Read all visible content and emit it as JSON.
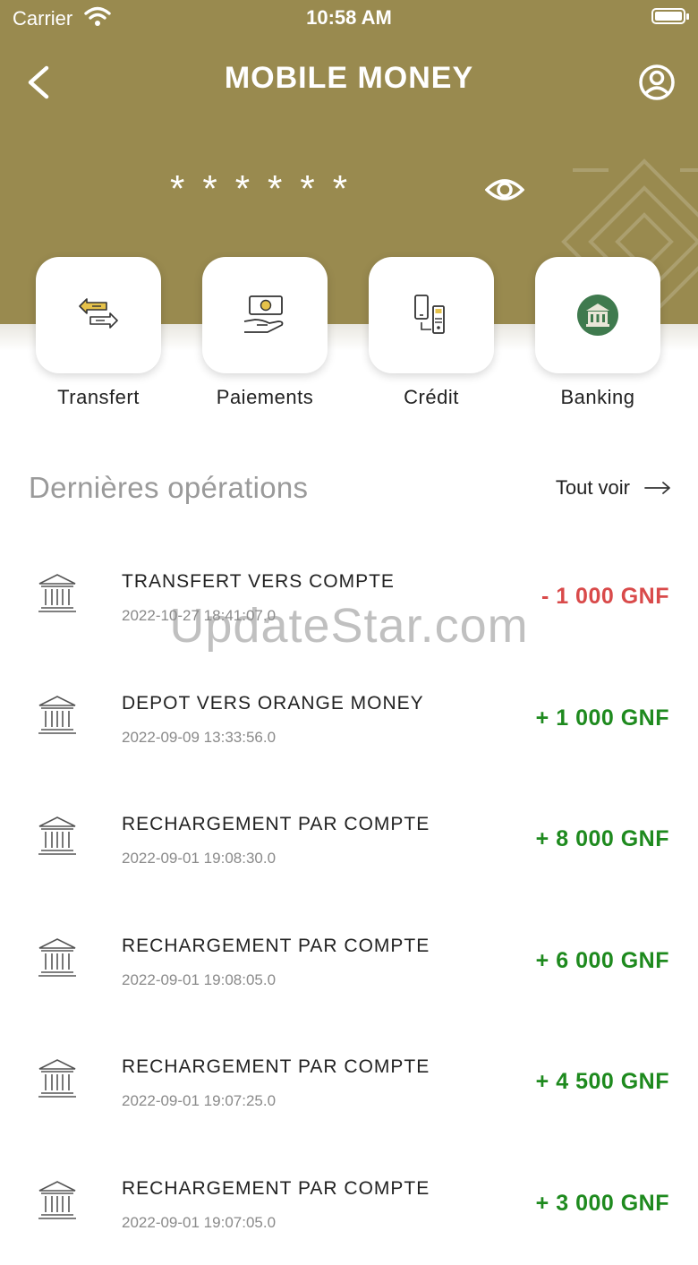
{
  "status_bar": {
    "carrier": "Carrier",
    "time": "10:58 AM"
  },
  "nav": {
    "title": "MOBILE MONEY"
  },
  "balance": {
    "masked": "******"
  },
  "actions": [
    {
      "label": "Transfert",
      "icon": "transfer-icon"
    },
    {
      "label": "Paiements",
      "icon": "payment-icon"
    },
    {
      "label": "Crédit",
      "icon": "credit-icon"
    },
    {
      "label": "Banking",
      "icon": "banking-icon"
    }
  ],
  "operations_section": {
    "title": "Dernières opérations",
    "see_all": "Tout voir"
  },
  "operations": [
    {
      "title": "TRANSFERT VERS COMPTE",
      "date": "2022-10-27 18:41:07.0",
      "amount": "- 1 000 GNF",
      "type": "debit"
    },
    {
      "title": "DEPOT VERS ORANGE MONEY",
      "date": "2022-09-09 13:33:56.0",
      "amount": "+ 1 000 GNF",
      "type": "credit"
    },
    {
      "title": "RECHARGEMENT PAR COMPTE",
      "date": "2022-09-01 19:08:30.0",
      "amount": "+ 8 000 GNF",
      "type": "credit"
    },
    {
      "title": "RECHARGEMENT PAR COMPTE",
      "date": "2022-09-01 19:08:05.0",
      "amount": "+ 6 000 GNF",
      "type": "credit"
    },
    {
      "title": "RECHARGEMENT PAR COMPTE",
      "date": "2022-09-01 19:07:25.0",
      "amount": "+ 4 500 GNF",
      "type": "credit"
    },
    {
      "title": "RECHARGEMENT PAR COMPTE",
      "date": "2022-09-01 19:07:05.0",
      "amount": "+ 3 000 GNF",
      "type": "credit"
    }
  ],
  "watermark": "UpdateStar.com",
  "colors": {
    "header": "#998a4f",
    "debit": "#d94a4a",
    "credit": "#1e8a1e",
    "banking_badge": "#3f7a4e"
  }
}
